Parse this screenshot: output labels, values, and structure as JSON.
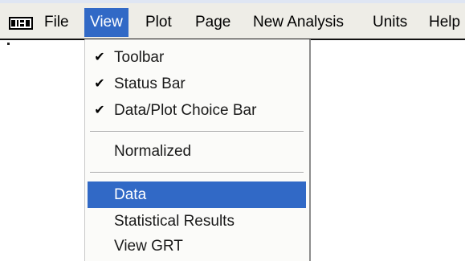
{
  "menubar": {
    "items": [
      {
        "label": "File"
      },
      {
        "label": "View"
      },
      {
        "label": "Plot"
      },
      {
        "label": "Page"
      },
      {
        "label": "New Analysis"
      },
      {
        "label": "Units"
      },
      {
        "label": "Help"
      }
    ],
    "active_item": "View",
    "app_icon": "application-icon"
  },
  "view_menu": {
    "items": [
      {
        "label": "Toolbar",
        "checked": true
      },
      {
        "label": "Status Bar",
        "checked": true
      },
      {
        "label": "Data/Plot Choice Bar",
        "checked": true
      },
      {
        "label": "Normalized",
        "checked": false
      },
      {
        "label": "Data",
        "checked": false,
        "highlighted": true
      },
      {
        "label": "Statistical Results",
        "checked": false
      },
      {
        "label": "View GRT",
        "checked": false
      }
    ],
    "check_glyph": "✔"
  },
  "colors": {
    "highlight": "#3169c6",
    "menubar_bg": "#eeede7",
    "menu_bg": "#fbfbf9"
  }
}
